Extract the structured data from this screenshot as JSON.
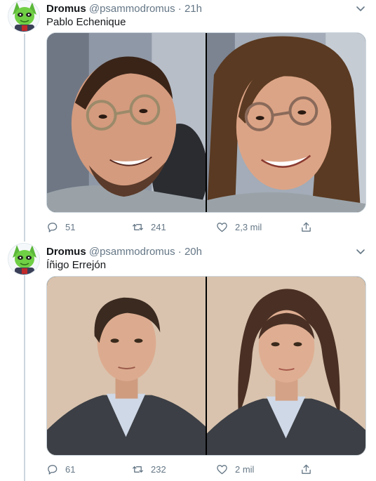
{
  "tweets": [
    {
      "display_name": "Dromus",
      "handle": "@psammodromus",
      "separator": "·",
      "time": "21h",
      "text": "Pablo Echenique",
      "reply_count": "51",
      "retweet_count": "241",
      "like_count": "2,3 mil"
    },
    {
      "display_name": "Dromus",
      "handle": "@psammodromus",
      "separator": "·",
      "time": "20h",
      "text": "Íñigo Errejón",
      "reply_count": "61",
      "retweet_count": "232",
      "like_count": "2 mil"
    }
  ],
  "icons": {
    "reply": "reply-icon",
    "retweet": "retweet-icon",
    "like": "heart-icon",
    "share": "share-icon",
    "caret": "chevron-down-icon"
  },
  "colors": {
    "text": "#14171a",
    "muted": "#657786",
    "thread_line": "#ccd6dd"
  }
}
